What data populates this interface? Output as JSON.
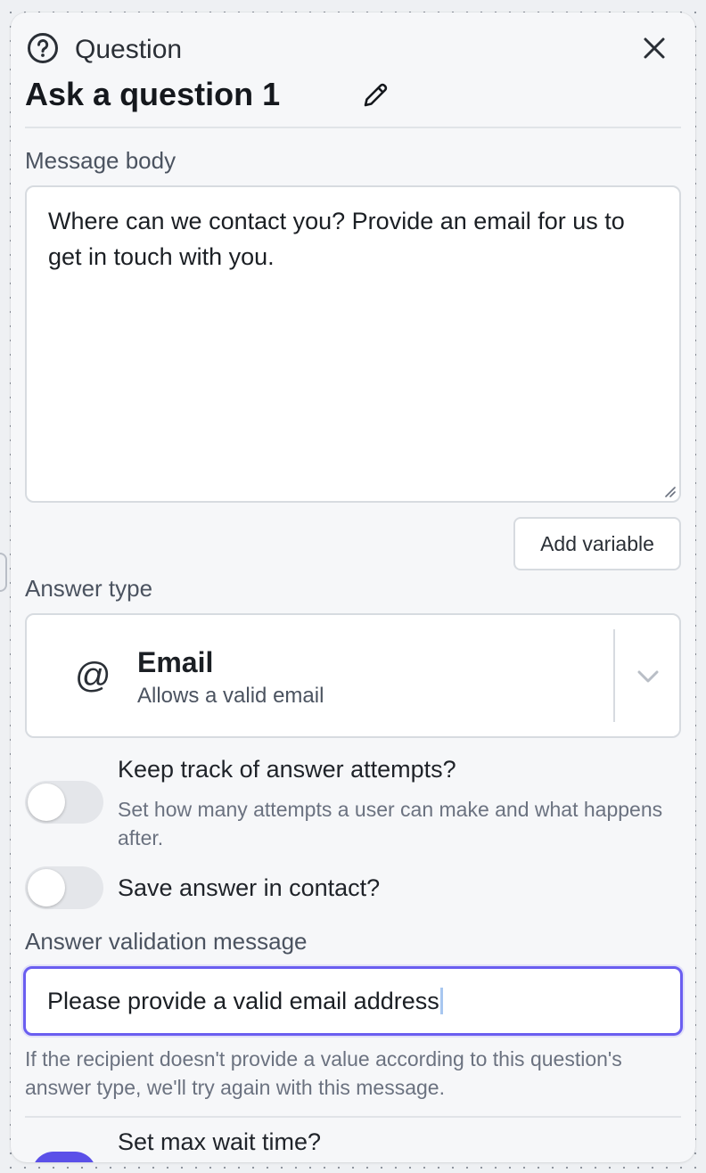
{
  "panel": {
    "kind_label": "Question",
    "title": "Ask a question 1",
    "icons": {
      "header": "question-circle-icon",
      "close": "close-icon",
      "edit": "pencil-icon",
      "answer_type": "at-sign-icon",
      "dropdown": "chevron-down-icon"
    }
  },
  "message_body": {
    "label": "Message body",
    "value": "Where can we contact you? Provide an email for us to get in touch with you.",
    "add_variable_label": "Add variable"
  },
  "answer_type": {
    "label": "Answer type",
    "selected_title": "Email",
    "selected_description": "Allows a valid email",
    "selected_symbol": "@"
  },
  "toggles": {
    "answer_attempts": {
      "title": "Keep track of answer attempts?",
      "description": "Set how many attempts a user can make and what happens after.",
      "enabled": false
    },
    "save_answer": {
      "title": "Save answer in contact?",
      "enabled": false
    },
    "max_wait_time": {
      "title": "Set max wait time?",
      "enabled": true
    }
  },
  "validation": {
    "label": "Answer validation message",
    "value": "Please provide a valid email address",
    "hint": "If the recipient doesn't provide a value according to this question's answer type, we'll try again with this message."
  },
  "colors": {
    "accent": "#6a5ef0",
    "toggle_on": "#5b50e8",
    "toggle_off": "#e4e6ea",
    "panel_bg": "#f6f7f9"
  }
}
